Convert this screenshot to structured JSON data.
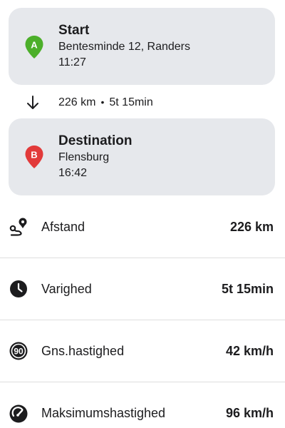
{
  "start": {
    "marker": "A",
    "title": "Start",
    "address": "Bentesminde 12, Randers",
    "time": "11:27",
    "icon": "map-pin-green-icon",
    "color": "#4caf2a"
  },
  "leg": {
    "icon": "arrow-down-icon",
    "distance": "226 km",
    "separator": "•",
    "duration": "5t 15min"
  },
  "destination": {
    "marker": "B",
    "title": "Destination",
    "address": "Flensburg",
    "time": "16:42",
    "icon": "map-pin-red-icon",
    "color": "#e23a3a"
  },
  "stats": [
    {
      "icon": "route-icon",
      "label": "Afstand",
      "value": "226 km"
    },
    {
      "icon": "clock-icon",
      "label": "Varighed",
      "value": "5t 15min"
    },
    {
      "icon": "speed-limit-90-icon",
      "label": "Gns.hastighed",
      "value": "42 km/h"
    },
    {
      "icon": "speedometer-icon",
      "label": "Maksimumshastighed",
      "value": "96 km/h"
    }
  ]
}
